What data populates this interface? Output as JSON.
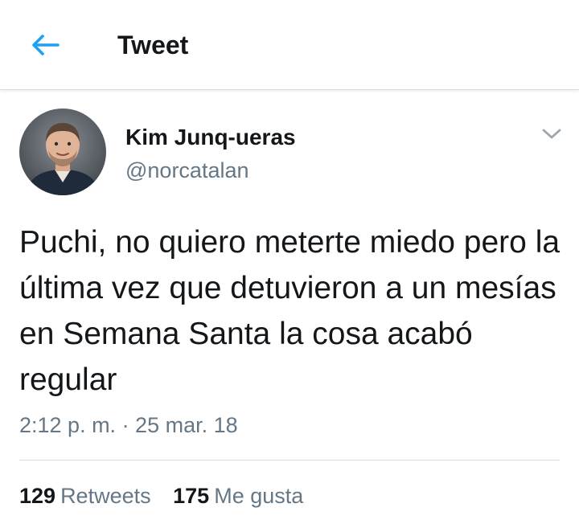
{
  "header": {
    "title": "Tweet",
    "back_icon": "arrow-left-icon",
    "accent_color": "#1da1f2"
  },
  "author": {
    "name": "Kim Junq-ueras",
    "handle": "@norcatalan",
    "avatar_icon": "profile-photo",
    "menu_icon": "chevron-down-icon"
  },
  "tweet": {
    "text": "Puchi, no quiero meterte miedo pero la última vez que detuvieron a un mesías en Semana Santa la cosa acabó regular",
    "timestamp": "2:12 p. m. · 25 mar. 18"
  },
  "stats": {
    "retweets_count": "129",
    "retweets_label": "Retweets",
    "likes_count": "175",
    "likes_label": "Me gusta"
  },
  "colors": {
    "primary_text": "#14171a",
    "secondary_text": "#657786",
    "divider": "#d8dde1"
  }
}
